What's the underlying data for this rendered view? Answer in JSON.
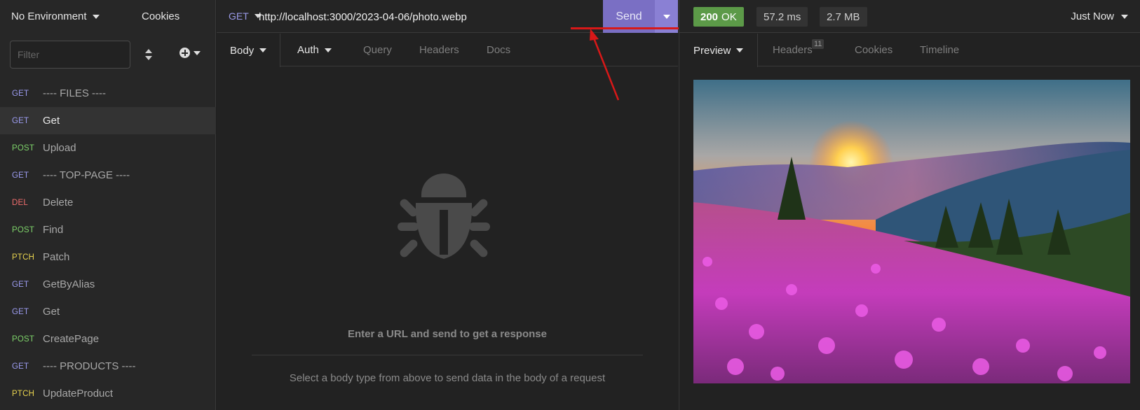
{
  "sidebar": {
    "environment": "No Environment",
    "cookies": "Cookies",
    "filter_placeholder": "Filter",
    "requests": [
      {
        "method": "GET",
        "name": "---- FILES ----",
        "color": "#9c9cf0"
      },
      {
        "method": "GET",
        "name": "Get",
        "color": "#9c9cf0",
        "active": true
      },
      {
        "method": "POST",
        "name": "Upload",
        "color": "#7ed36a"
      },
      {
        "method": "GET",
        "name": "---- TOP-PAGE ----",
        "color": "#9c9cf0"
      },
      {
        "method": "DEL",
        "name": "Delete",
        "color": "#f06d6d"
      },
      {
        "method": "POST",
        "name": "Find",
        "color": "#7ed36a"
      },
      {
        "method": "PTCH",
        "name": "Patch",
        "color": "#e8d34f"
      },
      {
        "method": "GET",
        "name": "GetByAlias",
        "color": "#9c9cf0"
      },
      {
        "method": "GET",
        "name": "Get",
        "color": "#9c9cf0"
      },
      {
        "method": "POST",
        "name": "CreatePage",
        "color": "#7ed36a"
      },
      {
        "method": "GET",
        "name": "---- PRODUCTS ----",
        "color": "#9c9cf0"
      },
      {
        "method": "PTCH",
        "name": "UpdateProduct",
        "color": "#e8d34f"
      }
    ]
  },
  "request": {
    "method": "GET",
    "url": "http://localhost:3000/2023-04-06/photo.webp",
    "send_label": "Send",
    "tabs": {
      "body": "Body",
      "auth": "Auth",
      "query": "Query",
      "headers": "Headers",
      "docs": "Docs"
    },
    "empty_title": "Enter a URL and send to get a response",
    "empty_hint": "Select a body type from above to send data in the body of a request"
  },
  "response": {
    "status_code": "200",
    "status_text": "OK",
    "time": "57.2 ms",
    "size": "2.7 MB",
    "history": "Just Now",
    "tabs": {
      "preview": "Preview",
      "headers": "Headers",
      "headers_count": "11",
      "cookies": "Cookies",
      "timeline": "Timeline"
    }
  },
  "colors": {
    "accent": "#7a6fc4",
    "status_ok": "#5c9a48",
    "annotation": "#d81818"
  }
}
